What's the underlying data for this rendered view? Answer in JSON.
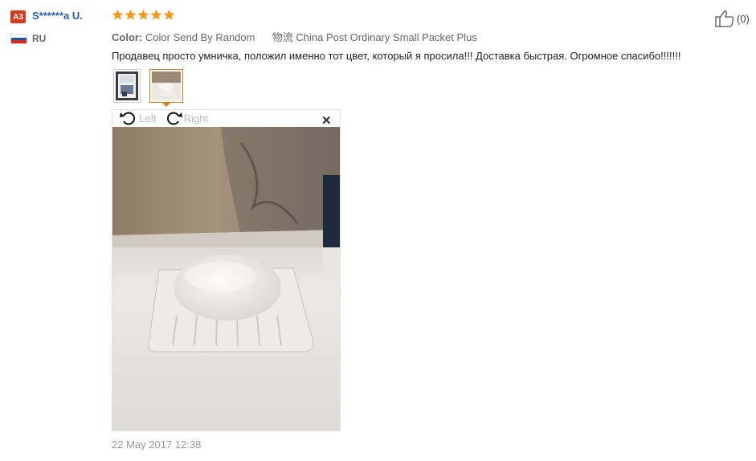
{
  "reviewer": {
    "badge": "A3",
    "name": "S******a U.",
    "country": "RU",
    "flag_colors": [
      "#ffffff",
      "#1c57a7",
      "#d52b1e"
    ]
  },
  "rating": {
    "stars": 5,
    "max": 5,
    "color": "#f29a1d"
  },
  "attributes": {
    "color_label": "Color:",
    "color_value": "Color Send By Random",
    "shipping_label": "物流",
    "shipping_value": "China Post Ordinary Small Packet Plus"
  },
  "review_text": "Продавец просто умничка, положил именно тот цвет, который я просила!!! Доставка быстрая. Огромное спасибо!!!!!!!",
  "helpful": {
    "count": "(0)",
    "icon": "thumbs-up-icon"
  },
  "viewer": {
    "rotate_left": "Left",
    "rotate_right": "Right",
    "close_icon": "close-icon"
  },
  "date": "22 May 2017 12:38",
  "colors": {
    "link": "#2a5db0",
    "accent": "#e07a1a",
    "badge": "#d93a1c"
  }
}
